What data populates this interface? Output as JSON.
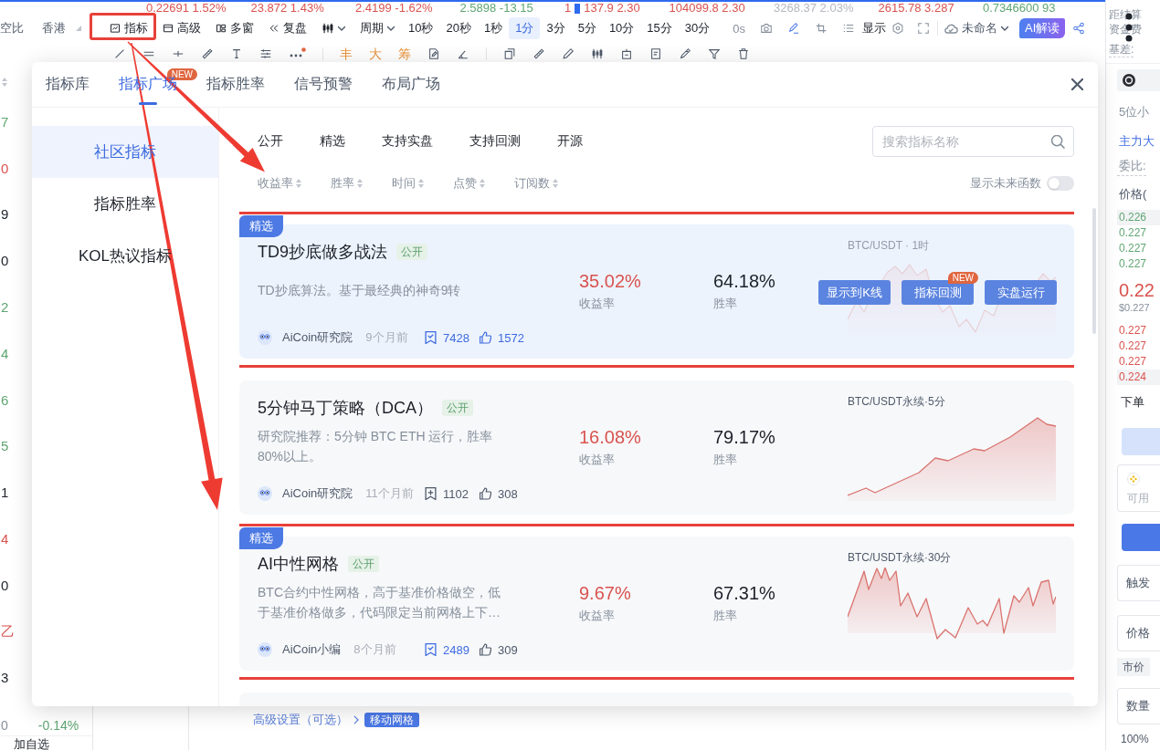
{
  "ticker": [
    {
      "text": "0.22691 1.52%",
      "color": "#d9534f"
    },
    {
      "text": "23.872 1.43%",
      "color": "#d9534f"
    },
    {
      "text": "2.4199 -1.62%",
      "color": "#d9534f"
    },
    {
      "text": "2.5898 -13.15",
      "color": "#5fa672"
    },
    {
      "prefix": "1",
      "text": "137.9 2.30",
      "color": "#d9534f"
    },
    {
      "text": "104099.8 2.30",
      "color": "#d9534f"
    },
    {
      "text": "3268.37 2.03%",
      "color": "#b3b8c0"
    },
    {
      "text": "2615.78 3.287",
      "color": "#d9534f"
    },
    {
      "text": "0.7346600 93",
      "color": "#5fa672"
    }
  ],
  "toolbar": {
    "region": [
      "空比",
      "香港"
    ],
    "tools": [
      {
        "label": "指标",
        "highlighted": true
      },
      {
        "label": "高级",
        "highlighted": false
      },
      {
        "label": "多窗",
        "highlighted": false
      },
      {
        "label": "复盘",
        "highlighted": false
      }
    ],
    "period": "周期",
    "intervals": [
      {
        "label": "10秒",
        "selected": false
      },
      {
        "label": "20秒",
        "selected": false
      },
      {
        "label": "1秒",
        "selected": false
      },
      {
        "label": "1分",
        "selected": true
      },
      {
        "label": "3分",
        "selected": false
      },
      {
        "label": "5分",
        "selected": false
      },
      {
        "label": "10分",
        "selected": false
      },
      {
        "label": "15分",
        "selected": false
      },
      {
        "label": "30分",
        "selected": false
      }
    ],
    "countdown": "0s",
    "display": "显示",
    "layout_name": "未命名",
    "ai_button": "AI解读"
  },
  "drawing_tools": {
    "labels": [
      "丰",
      "大",
      "筹"
    ]
  },
  "watchlist": {
    "values": [
      {
        "text": "7",
        "color": "#5fa672"
      },
      {
        "text": "0",
        "color": "#d9534f"
      },
      {
        "text": "9",
        "color": "#1d2129"
      },
      {
        "text": "0",
        "color": "#1d2129"
      },
      {
        "text": "2",
        "color": "#5fa672"
      },
      {
        "text": "4",
        "color": "#5fa672"
      },
      {
        "text": "6",
        "color": "#5fa672"
      },
      {
        "text": "5",
        "color": "#5fa672"
      },
      {
        "text": "1",
        "color": "#1d2129"
      },
      {
        "text": "4",
        "color": "#d9534f"
      },
      {
        "text": "0",
        "color": "#1d2129"
      },
      {
        "text": "乙",
        "color": "#d9534f"
      },
      {
        "text": "3",
        "color": "#1d2129"
      }
    ],
    "last_value": "0",
    "last_change": "-0.14%",
    "add_label": "加自选"
  },
  "background_form": {
    "link": "高级设置（可选）",
    "tag": "移动网格"
  },
  "right_panel": {
    "stats": [
      {
        "text": "距结算",
        "dashed": false
      },
      {
        "text": "资金费",
        "dashed": false
      },
      {
        "text": "基差:",
        "dashed": true
      }
    ],
    "precision": "5位小",
    "link": "主力大",
    "ratio_label": "委比:",
    "price_header": "价格(",
    "rows_above": [
      {
        "price": "0.226",
        "highlighted": true
      },
      {
        "price": "0.227",
        "highlighted": false
      },
      {
        "price": "0.227",
        "highlighted": false
      },
      {
        "price": "0.227",
        "highlighted": false
      }
    ],
    "last_price": "0.22",
    "last_price_usd": "$0.227",
    "rows_below": [
      {
        "price": "0.227",
        "highlighted": false
      },
      {
        "price": "0.227",
        "highlighted": false
      },
      {
        "price": "0.227",
        "highlighted": false
      },
      {
        "price": "0.224",
        "highlighted": true
      }
    ],
    "order_title": "下单",
    "available_label": "可用",
    "fields": [
      {
        "label": "触发"
      },
      {
        "label": "价格"
      }
    ],
    "order_type": "市价",
    "quantity_label": "数量",
    "percent": "100%"
  },
  "dialog": {
    "tabs": [
      {
        "label": "指标库",
        "selected": false
      },
      {
        "label": "指标广场",
        "selected": true,
        "badge": "NEW"
      },
      {
        "label": "指标胜率",
        "selected": false
      },
      {
        "label": "信号预警",
        "selected": false
      },
      {
        "label": "布局广场",
        "selected": false
      }
    ],
    "sidebar": [
      {
        "label": "社区指标",
        "selected": true
      },
      {
        "label": "指标胜率",
        "selected": false
      },
      {
        "label": "KOL热议指标",
        "selected": false
      }
    ],
    "filters": [
      "公开",
      "精选",
      "支持实盘",
      "支持回测",
      "开源"
    ],
    "search": {
      "placeholder": "搜索指标名称"
    },
    "sort_options": [
      "收益率",
      "胜率",
      "时间",
      "点赞",
      "订阅数"
    ],
    "future_toggle": {
      "label": "显示未来函数",
      "on": false
    },
    "cards": [
      {
        "badge": "精选",
        "title": "TD9抄底做多战法",
        "tag": "公开",
        "description": "TD抄底算法。基于最经典的神奇9转",
        "return": "35.02%",
        "return_label": "收益率",
        "win_rate": "64.18%",
        "win_rate_label": "胜率",
        "chart": {
          "label": "BTC/USDT · 1时",
          "kind": "wavy"
        },
        "author": "AiCoin研究院",
        "time": "9个月前",
        "bookmarks": "7428",
        "bookmarked": true,
        "likes": "1572",
        "liked": true,
        "hovered": true,
        "highlighted": true,
        "actions": [
          {
            "label": "显示到K线"
          },
          {
            "label": "指标回测",
            "badge": "NEW"
          },
          {
            "label": "实盘运行"
          }
        ]
      },
      {
        "title": "5分钟马丁策略（DCA）",
        "tag": "公开",
        "description": "研究院推荐：5分钟 BTC ETH 运行，胜率80%以上。",
        "return": "16.08%",
        "return_label": "收益率",
        "win_rate": "79.17%",
        "win_rate_label": "胜率",
        "chart": {
          "label": "BTC/USDT永续·5分",
          "kind": "rising"
        },
        "author": "AiCoin研究院",
        "time": "11个月前",
        "bookmarks": "1102",
        "bookmarked": false,
        "likes": "308",
        "liked": false,
        "hovered": false,
        "highlighted": false
      },
      {
        "badge": "精选",
        "title": "AI中性网格",
        "tag": "公开",
        "description": "BTC合约中性网格，高于基准价格做空，低于基准价格做多，代码限定当前网格上下…",
        "return": "9.67%",
        "return_label": "收益率",
        "win_rate": "67.31%",
        "win_rate_label": "胜率",
        "chart": {
          "label": "BTC/USDT永续·30分",
          "kind": "choppy"
        },
        "author": "AiCoin小编",
        "time": "8个月前",
        "bookmarks": "2489",
        "bookmarked": true,
        "likes": "309",
        "liked": false,
        "hovered": false,
        "highlighted": true
      }
    ]
  }
}
